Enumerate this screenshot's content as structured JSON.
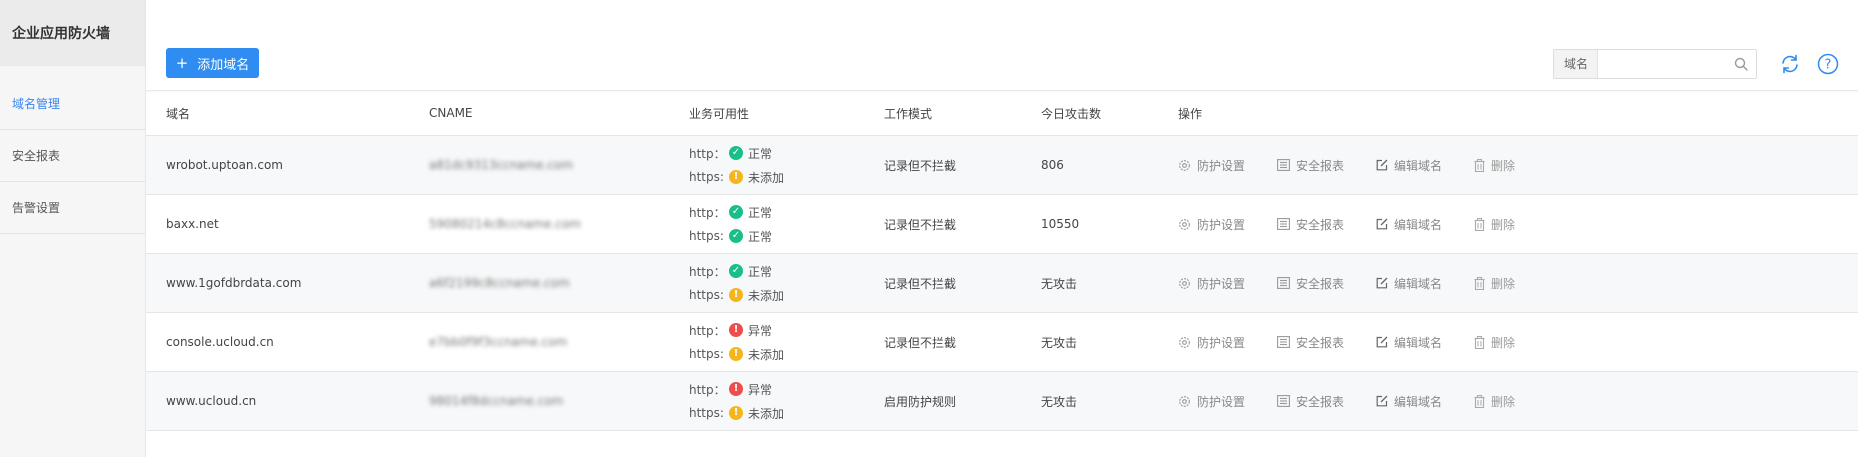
{
  "sidebar": {
    "title": "企业应用防火墙",
    "items": [
      {
        "label": "域名管理",
        "active": true
      },
      {
        "label": "安全报表",
        "active": false
      },
      {
        "label": "告警设置",
        "active": false
      }
    ]
  },
  "toolbar": {
    "add_button": "添加域名",
    "search_prefix": "域名",
    "search_value": "",
    "search_placeholder": ""
  },
  "table": {
    "headers": [
      "域名",
      "CNAME",
      "业务可用性",
      "工作模式",
      "今日攻击数",
      "操作"
    ],
    "rows": [
      {
        "domain": "wrobot.uptoan.com",
        "cname": "a81dc9313ccname.com",
        "http_label": "http：",
        "http_status": "ok",
        "http_text": "正常",
        "https_label": "https:",
        "https_status": "warn",
        "https_text": "未添加",
        "mode": "记录但不拦截",
        "attacks": "806"
      },
      {
        "domain": "baxx.net",
        "cname": "59080214c8ccname.com",
        "http_label": "http：",
        "http_status": "ok",
        "http_text": "正常",
        "https_label": "https:",
        "https_status": "ok",
        "https_text": "正常",
        "mode": "记录但不拦截",
        "attacks": "10550"
      },
      {
        "domain": "www.1gofdbrdata.com",
        "cname": "a6f2199c8ccname.com",
        "http_label": "http：",
        "http_status": "ok",
        "http_text": "正常",
        "https_label": "https:",
        "https_status": "warn",
        "https_text": "未添加",
        "mode": "记录但不拦截",
        "attacks": "无攻击"
      },
      {
        "domain": "console.ucloud.cn",
        "cname": "e7bb0f9f3ccname.com",
        "http_label": "http：",
        "http_status": "err",
        "http_text": "异常",
        "https_label": "https:",
        "https_status": "warn",
        "https_text": "未添加",
        "mode": "记录但不拦截",
        "attacks": "无攻击"
      },
      {
        "domain": "www.ucloud.cn",
        "cname": "98014f8dccname.com",
        "http_label": "http：",
        "http_status": "err",
        "http_text": "异常",
        "https_label": "https:",
        "https_status": "warn",
        "https_text": "未添加",
        "mode": "启用防护规则",
        "attacks": "无攻击"
      }
    ],
    "actions": {
      "protect": "防护设置",
      "report": "安全报表",
      "edit": "编辑域名",
      "delete": "删除"
    },
    "status_glyphs": {
      "ok": "✓",
      "warn": "!",
      "err": "!"
    },
    "status_colors": {
      "ok": "#19be8a",
      "warn": "#f5b61d",
      "err": "#ed4d4d"
    }
  },
  "colors": {
    "accent": "#2f8cf0",
    "sidebar_bg": "#f6f6f6"
  },
  "icons": {
    "search": "search-icon",
    "refresh": "refresh-icon",
    "help": "help-icon",
    "protect": "gear-icon",
    "report": "list-icon",
    "edit": "edit-icon",
    "delete": "trash-icon"
  }
}
